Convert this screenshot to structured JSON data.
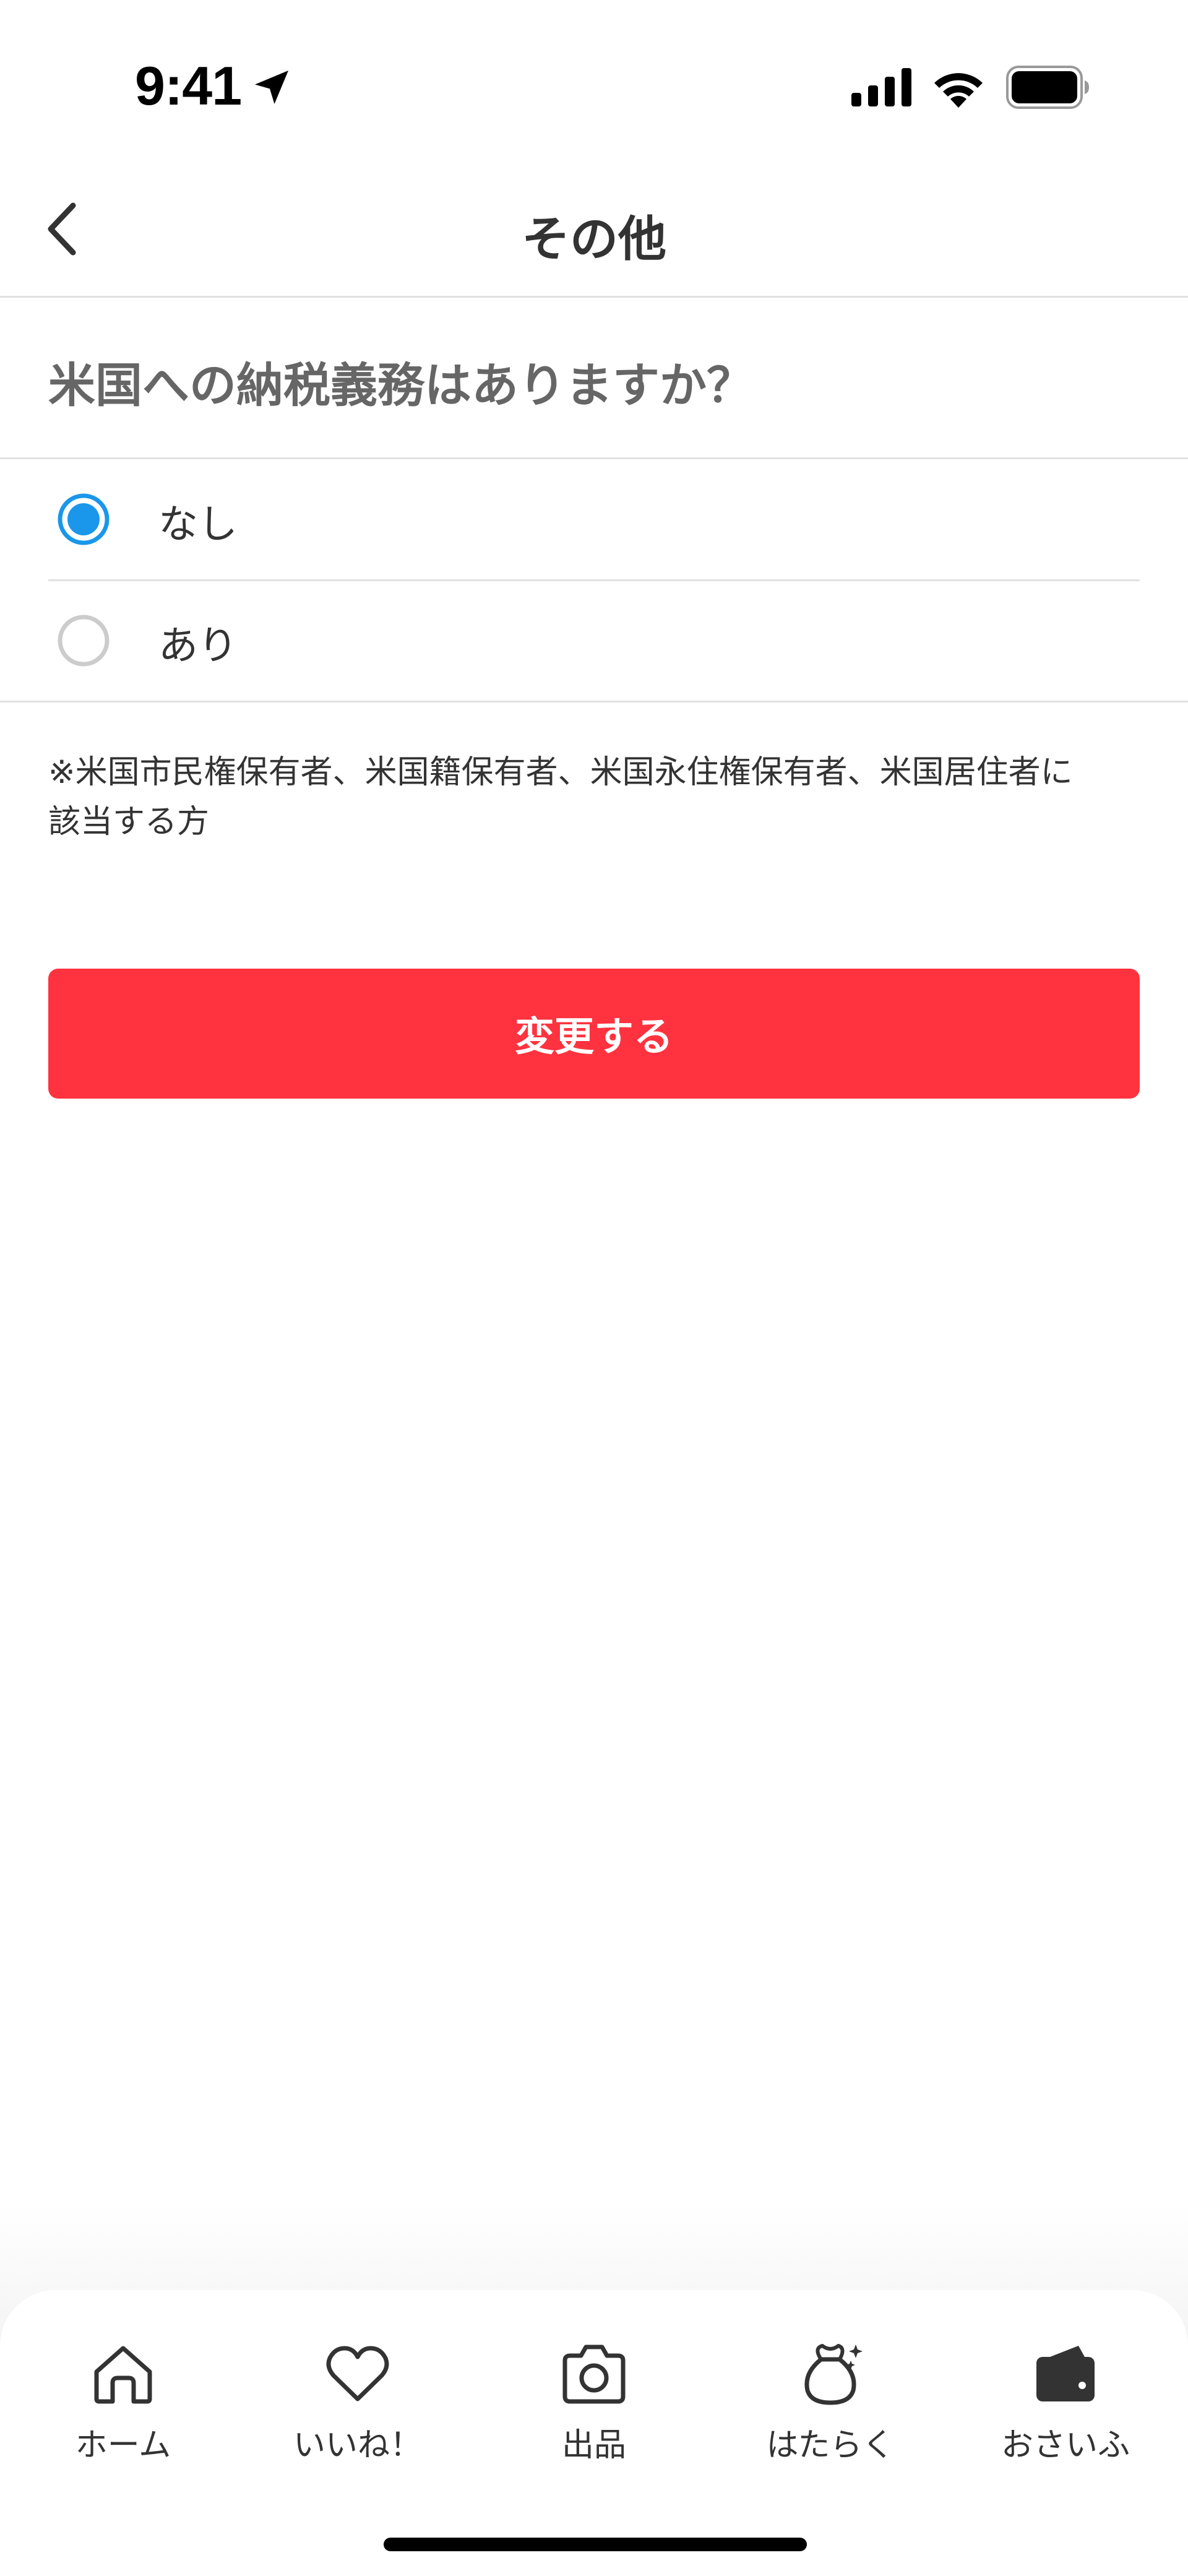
{
  "status_bar": {
    "time": "9:41"
  },
  "nav": {
    "title": "その他"
  },
  "question": {
    "text": "米国への納税義務はありますか？"
  },
  "options": [
    {
      "label": "なし",
      "selected": true
    },
    {
      "label": "あり",
      "selected": false
    }
  ],
  "note": {
    "line1": "※米国市民権保有者、米国籍保有者、米国永住権保有者、米国居住者に",
    "line2": "該当する方"
  },
  "submit": {
    "label": "変更する"
  },
  "tabs": [
    {
      "label": "ホーム",
      "icon": "home-icon"
    },
    {
      "label": "いいね！",
      "icon": "heart-icon"
    },
    {
      "label": "出品",
      "icon": "camera-icon"
    },
    {
      "label": "はたらく",
      "icon": "money-bag-icon"
    },
    {
      "label": "おさいふ",
      "icon": "wallet-icon"
    }
  ],
  "colors": {
    "accent": "#ff333f",
    "radio_selected": "#1a97ea",
    "radio_unselected": "#cccccc",
    "divider": "#e1e1e1"
  }
}
